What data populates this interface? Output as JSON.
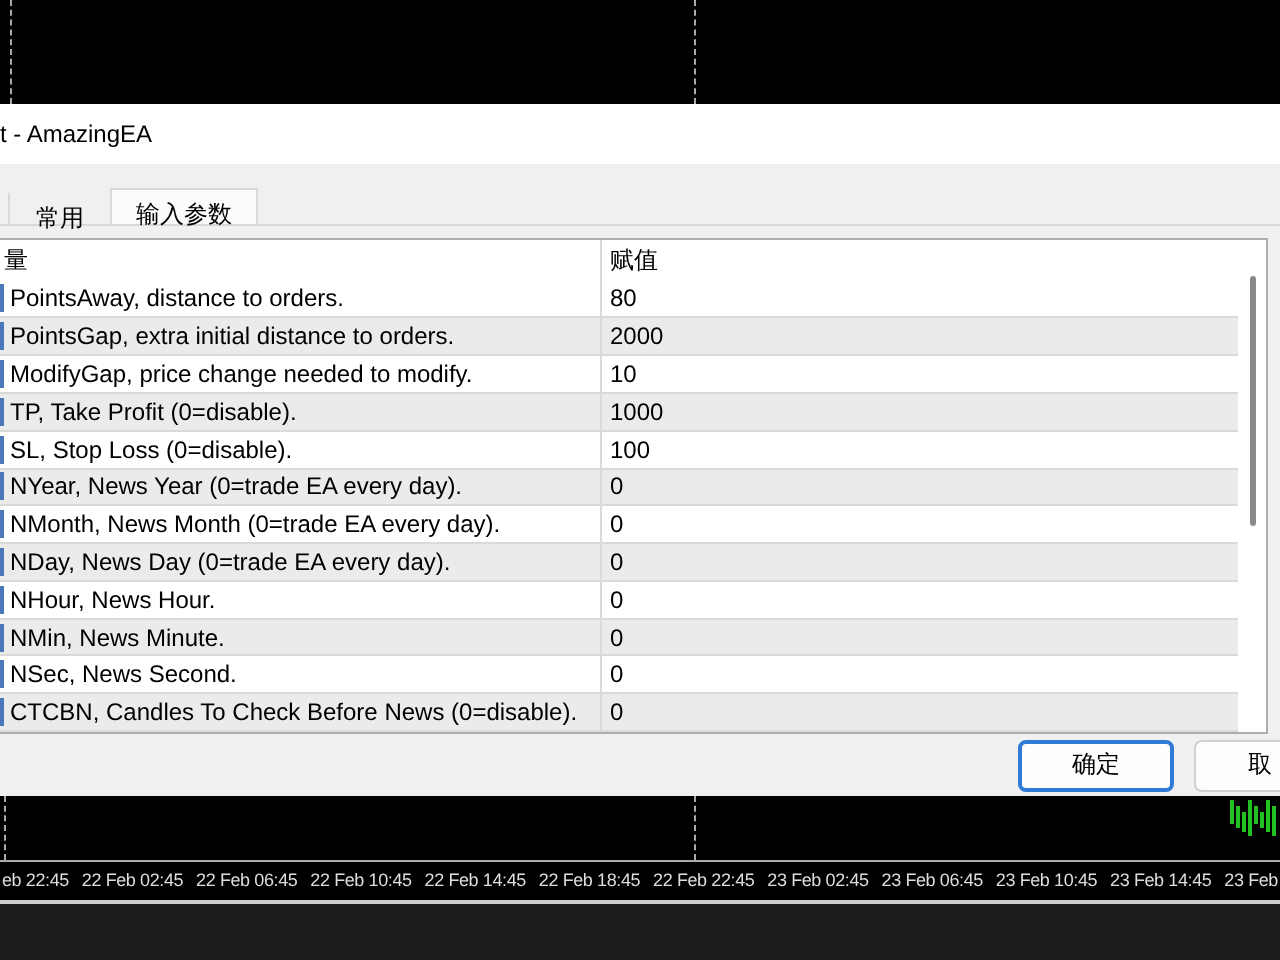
{
  "window": {
    "title": "t - AmazingEA"
  },
  "tabs": [
    {
      "selected": false
    },
    {
      "label": "常用",
      "selected": false
    },
    {
      "label": "输入参数",
      "selected": true
    }
  ],
  "table": {
    "columns": [
      "量",
      "赋值"
    ],
    "rows": [
      {
        "variable": "PointsAway, distance to orders.",
        "value": "80"
      },
      {
        "variable": "PointsGap, extra initial distance to orders.",
        "value": "2000"
      },
      {
        "variable": "ModifyGap, price change needed to modify.",
        "value": "10"
      },
      {
        "variable": "TP, Take Profit (0=disable).",
        "value": "1000"
      },
      {
        "variable": "SL, Stop Loss (0=disable).",
        "value": "100"
      },
      {
        "variable": "NYear, News Year (0=trade EA every day).",
        "value": "0"
      },
      {
        "variable": "NMonth, News Month (0=trade EA every day).",
        "value": "0"
      },
      {
        "variable": "NDay, News Day (0=trade EA every day).",
        "value": "0"
      },
      {
        "variable": "NHour, News Hour.",
        "value": "0"
      },
      {
        "variable": "NMin, News Minute.",
        "value": "0"
      },
      {
        "variable": "NSec, News Second.",
        "value": "0"
      },
      {
        "variable": "CTCBN, Candles To Check Before News (0=disable).",
        "value": "0"
      }
    ]
  },
  "buttons": [
    "确定",
    "取"
  ],
  "chart": {
    "time_labels": [
      "eb 22:45",
      "22 Feb 02:45",
      "22 Feb 06:45",
      "22 Feb 10:45",
      "22 Feb 14:45",
      "22 Feb 18:45",
      "22 Feb 22:45",
      "23 Feb 02:45",
      "23 Feb 06:45",
      "23 Feb 10:45",
      "23 Feb 14:45",
      "23 Feb"
    ]
  }
}
